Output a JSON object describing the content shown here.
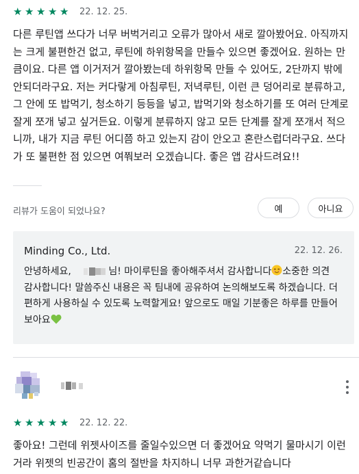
{
  "review1": {
    "rating": 5,
    "date": "22. 12. 25.",
    "text": "다른 루틴앱 쓰다가 너무 버벅거리고 오류가 많아서 새로 깔아봤어요. 아직까지는 크게 불편한건 없고, 루틴에 하위항목을 만들수 있으면 좋겠어요. 원하는 만큼이요. 다른 앱 이거저거 깔아봤는데 하위항목 만들 수 있어도, 2단까지 밖에 안되더라구요. 저는 커다랗게 아침루틴, 저녁루틴, 이런 큰 덩어리로 분류하고, 그 안에 또 밥먹기, 청소하기 등등을 넣고, 밥먹기와 청소하기를 또 여러 단계로 잘게 쪼개 넣고 싶거든요. 이렇게 분류하지 않고 모든 단계를 잘게 쪼개서 적으니까, 내가 지금 루틴 어디쯤 하고 있는지 감이 안오고 혼란스럽더라구요. 쓰다가 또 불편한 점 있으면 여쭤보러 오겠습니다. 좋은 앱 감사드려요!!"
  },
  "helpful": {
    "question": "리뷰가 도움이 되었나요?",
    "yes": "예",
    "no": "아니요"
  },
  "reply": {
    "developer": "Minding Co., Ltd.",
    "date": "22. 12. 26.",
    "greeting": "안녕하세요,",
    "body1": "님! 마이루틴을 좋아해주셔서 감사합니다",
    "body2": "소중한 의견 감사합니다! 말씀주신 내용은 꼭 팀내에 공유하여 논의해보도록 하겠습니다. 더 편하게 사용하실 수 있도록 노력할게요! 앞으로도 매일 기분좋은 하루를 만들어보아요",
    "emoji1": "smile-emoji-icon",
    "emoji2": "green-heart-emoji-icon"
  },
  "review2": {
    "rating": 5,
    "date": "22. 12. 22.",
    "text": "좋아요! 그런데 위젯사이즈를 줄일수있으면 더 좋겠어요 약먹기 물마시기 이런거라 위젯의 빈공간이 홈의 절반을 차지하니 너무 과한거같습니다",
    "menu_icon": "more-vert-icon"
  },
  "colors": {
    "star": "#01875f",
    "reply_bg": "#f1f3f4",
    "divider": "#dadce0"
  }
}
